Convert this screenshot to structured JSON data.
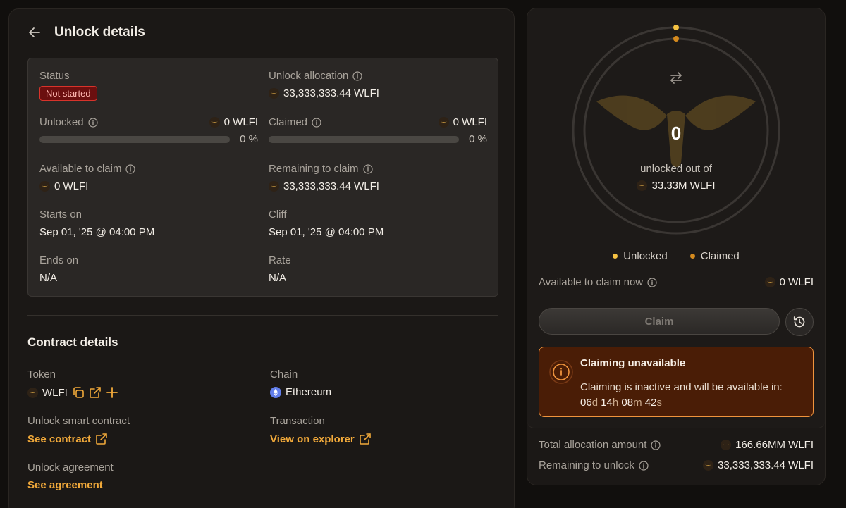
{
  "header": {
    "title": "Unlock details"
  },
  "details": {
    "status_label": "Status",
    "status_value": "Not started",
    "allocation_label": "Unlock allocation",
    "allocation_value": "33,333,333.44 WLFI",
    "unlocked_label": "Unlocked",
    "unlocked_amount": "0 WLFI",
    "unlocked_pct": "0 %",
    "unlocked_progress": 0,
    "claimed_label": "Claimed",
    "claimed_amount": "0 WLFI",
    "claimed_pct": "0 %",
    "claimed_progress": 0,
    "available_label": "Available to claim",
    "available_value": "0 WLFI",
    "remaining_label": "Remaining to claim",
    "remaining_value": "33,333,333.44 WLFI",
    "starts_label": "Starts on",
    "starts_value": "Sep 01, '25 @ 04:00 PM",
    "cliff_label": "Cliff",
    "cliff_value": "Sep 01, '25 @ 04:00 PM",
    "ends_label": "Ends on",
    "ends_value": "N/A",
    "rate_label": "Rate",
    "rate_value": "N/A"
  },
  "contract": {
    "title": "Contract details",
    "token_label": "Token",
    "token_value": "WLFI",
    "chain_label": "Chain",
    "chain_value": "Ethereum",
    "smart_contract_label": "Unlock smart contract",
    "smart_contract_link": "See contract",
    "transaction_label": "Transaction",
    "transaction_link": "View on explorer",
    "agreement_label": "Unlock agreement",
    "agreement_link": "See agreement"
  },
  "summary": {
    "unlocked_count": "0",
    "unlocked_out_of": "unlocked out of",
    "total": "33.33M WLFI",
    "legend_unlocked": "Unlocked",
    "legend_claimed": "Claimed",
    "available_now_label": "Available to claim now",
    "available_now_value": "0 WLFI",
    "claim_button": "Claim",
    "alert_title": "Claiming unavailable",
    "alert_body": "Claiming is inactive and will be available in:",
    "countdown": {
      "d": "06",
      "d_unit": "d",
      "h": "14",
      "h_unit": "h",
      "m": "08",
      "m_unit": "m",
      "s": "42",
      "s_unit": "s"
    },
    "total_allocation_label": "Total allocation amount",
    "total_allocation_value": "166.66MM WLFI",
    "remaining_unlock_label": "Remaining to unlock",
    "remaining_unlock_value": "33,333,333.44 WLFI"
  },
  "colors": {
    "accent": "#f1a93a",
    "unlocked_dot": "#f5c242",
    "claimed_dot": "#d48a1e",
    "status_bg": "#6b0f0f",
    "status_border": "#d8332b",
    "alert_bg": "#4a1d06",
    "alert_border": "#f0943d"
  },
  "icons": {
    "back": "arrow-left-icon",
    "info": "info-icon",
    "token": "wlfi-token-icon",
    "copy": "copy-icon",
    "external": "external-link-icon",
    "add": "plus-icon",
    "chain": "ethereum-icon",
    "swap": "swap-arrows-icon",
    "history": "history-icon",
    "alert": "alert-info-icon"
  }
}
